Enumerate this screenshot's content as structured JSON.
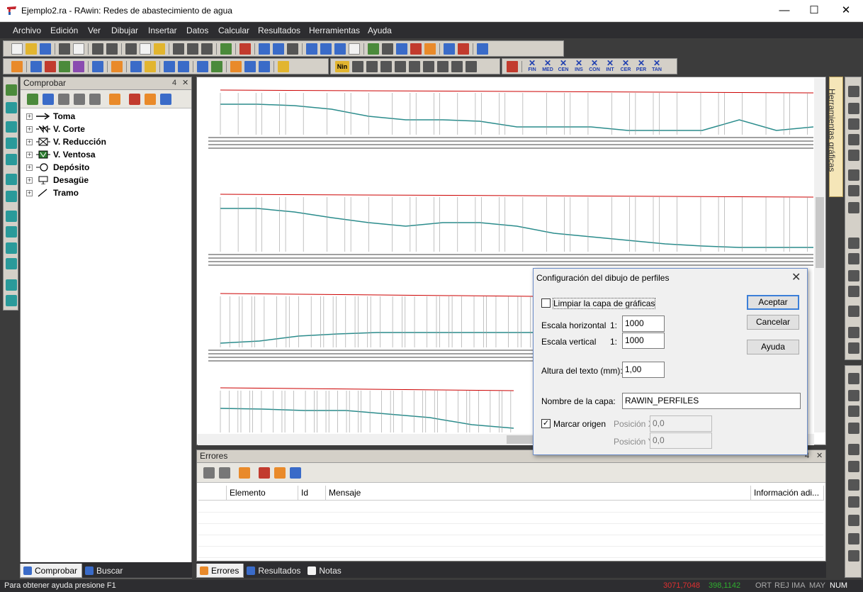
{
  "window": {
    "title": "Ejemplo2.ra - RAwin: Redes de abastecimiento de agua",
    "minimize": "—",
    "maximize": "☐",
    "close": "✕"
  },
  "menu": [
    "Archivo",
    "Edición",
    "Ver",
    "Dibujar",
    "Insertar",
    "Datos",
    "Calcular",
    "Resultados",
    "Herramientas",
    "Ayuda"
  ],
  "toolbar_labels": [
    "FIN",
    "MED",
    "CEN",
    "INS",
    "CON",
    "INT",
    "CER",
    "PER",
    "TAN"
  ],
  "toolbar_nin": "Nin",
  "panel_comprobar": {
    "title": "Comprobar",
    "pin": "4",
    "close": "✕",
    "tree": [
      {
        "label": "Toma",
        "icon": "arrow-icon"
      },
      {
        "label": "V. Corte",
        "icon": "gate-valve-icon"
      },
      {
        "label": "V. Reducción",
        "icon": "reducing-valve-icon"
      },
      {
        "label": "V. Ventosa",
        "icon": "air-valve-icon"
      },
      {
        "label": "Depósito",
        "icon": "tank-icon"
      },
      {
        "label": "Desagüe",
        "icon": "drain-icon"
      },
      {
        "label": "Tramo",
        "icon": "pipe-icon"
      }
    ],
    "tabs": [
      "Comprobar",
      "Buscar"
    ]
  },
  "panel_errores": {
    "title": "Errores",
    "pin": "4",
    "close": "✕",
    "columns": [
      "",
      "Elemento",
      "Id",
      "Mensaje",
      "Información adi..."
    ],
    "tabs": [
      "Errores",
      "Resultados",
      "Notas"
    ]
  },
  "right_panel": {
    "label": "Herramientas gráficas"
  },
  "dialog": {
    "title": "Configuración del dibujo de perfiles",
    "close": "✕",
    "clear_layer_label": "Limpiar la capa de gráficas",
    "clear_layer_checked": false,
    "h_scale_label": "Escala horizontal",
    "h_scale_prefix": "1:",
    "h_scale_value": "1000",
    "v_scale_label": "Escala vertical",
    "v_scale_prefix": "1:",
    "v_scale_value": "1000",
    "text_height_label": "Altura del texto (mm):",
    "text_height_value": "1,00",
    "layer_name_label": "Nombre de la capa:",
    "layer_name_value": "RAWIN_PERFILES",
    "mark_origin_label": "Marcar origen",
    "mark_origin_checked": true,
    "pos_x_label": "Posición X:",
    "pos_x_value": "0,0",
    "pos_y_label": "Posición Y:",
    "pos_y_value": "0,0",
    "ok": "Aceptar",
    "cancel": "Cancelar",
    "help": "Ayuda"
  },
  "status": {
    "help_text": "Para obtener ayuda presione F1",
    "coord_x": "3071,7048",
    "coord_y": "398,1142",
    "flags": [
      "ORT",
      "REJ",
      "IMA",
      "MAY",
      "NUM"
    ]
  },
  "colors": {
    "red_line": "#cc0000",
    "teal_line": "#2a8c8c",
    "panel_dark": "#2d2d30",
    "dialog_accent": "#3c7fd8"
  }
}
